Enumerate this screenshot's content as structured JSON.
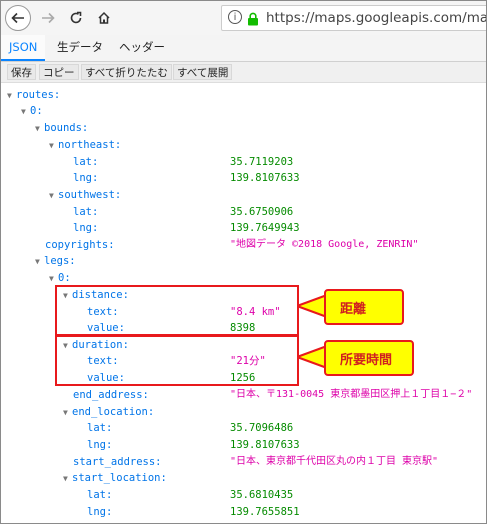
{
  "browser": {
    "url": "https://maps.googleapis.com/maps/a"
  },
  "tabs": [
    {
      "label": "JSON",
      "active": true
    },
    {
      "label": "生データ",
      "active": false
    },
    {
      "label": "ヘッダー",
      "active": false
    }
  ],
  "toolbar": {
    "save": "保存",
    "copy": "コピー",
    "collapse_all": "すべて折りたたむ",
    "expand_all": "すべて展開"
  },
  "tree": {
    "routes": "routes:",
    "r0": "0:",
    "bounds": "bounds:",
    "northeast": "northeast:",
    "ne_lat_k": "lat:",
    "ne_lat_v": "35.7119203",
    "ne_lng_k": "lng:",
    "ne_lng_v": "139.8107633",
    "southwest": "southwest:",
    "sw_lat_k": "lat:",
    "sw_lat_v": "35.6750906",
    "sw_lng_k": "lng:",
    "sw_lng_v": "139.7649943",
    "copyrights_k": "copyrights:",
    "copyrights_v": "\"地図データ ©2018 Google, ZENRIN\"",
    "legs": "legs:",
    "l0": "0:",
    "distance": "distance:",
    "d_text_k": "text:",
    "d_text_v": "\"8.4 km\"",
    "d_value_k": "value:",
    "d_value_v": "8398",
    "duration": "duration:",
    "du_text_k": "text:",
    "du_text_v": "\"21分\"",
    "du_value_k": "value:",
    "du_value_v": "1256",
    "end_address_k": "end_address:",
    "end_address_v": "\"日本、〒131-0045 東京都墨田区押上１丁目１−２\"",
    "end_location": "end_location:",
    "el_lat_k": "lat:",
    "el_lat_v": "35.7096486",
    "el_lng_k": "lng:",
    "el_lng_v": "139.8107633",
    "start_address_k": "start_address:",
    "start_address_v": "\"日本、東京都千代田区丸の内１丁目 東京駅\"",
    "start_location": "start_location:",
    "sl_lat_k": "lat:",
    "sl_lat_v": "35.6810435",
    "sl_lng_k": "lng:",
    "sl_lng_v": "139.7655851"
  },
  "callouts": {
    "distance": "距離",
    "duration": "所要時間"
  },
  "colors": {
    "key": "#0074e8",
    "number": "#058b00",
    "string": "#dd00a9",
    "highlight": "#e8191c",
    "callout_bg": "#ffff00"
  }
}
